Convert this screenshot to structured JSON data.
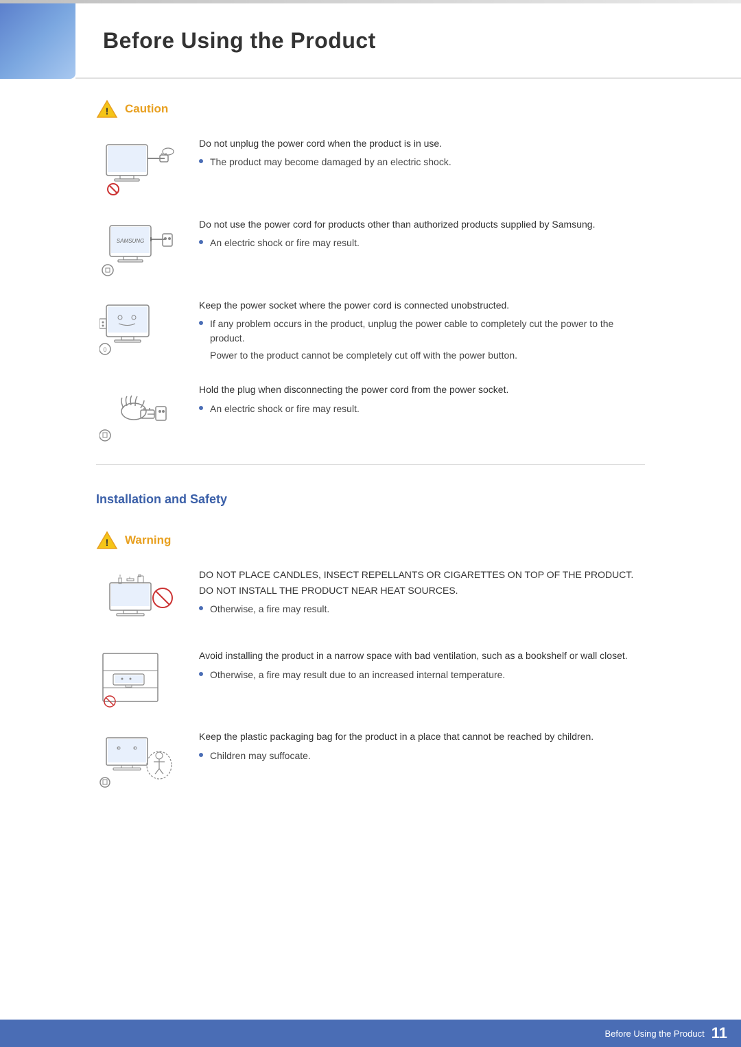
{
  "page": {
    "title": "Before Using the Product",
    "page_number": "11",
    "footer_label": "Before Using the Product"
  },
  "caution_section": {
    "heading": "Caution",
    "blocks": [
      {
        "id": "block1",
        "main_text": "Do not unplug the power cord when the product is in use.",
        "bullets": [
          "The product may become damaged by an electric shock."
        ],
        "sub_texts": []
      },
      {
        "id": "block2",
        "main_text": "Do not use the power cord for products other than authorized products supplied by Samsung.",
        "bullets": [
          "An electric shock or fire may result."
        ],
        "sub_texts": []
      },
      {
        "id": "block3",
        "main_text": "Keep the power socket where the power cord is connected unobstructed.",
        "bullets": [
          "If any problem occurs in the product, unplug the power cable to completely cut the power to the product."
        ],
        "sub_texts": [
          "Power to the product cannot be completely cut off with the power button."
        ]
      },
      {
        "id": "block4",
        "main_text": "Hold the plug when disconnecting the power cord from the power socket.",
        "bullets": [
          "An electric shock or fire may result."
        ],
        "sub_texts": []
      }
    ]
  },
  "install_section": {
    "heading": "Installation and Safety",
    "warning_heading": "Warning",
    "blocks": [
      {
        "id": "iblock1",
        "main_text": "DO NOT PLACE CANDLES, INSECT REPELLANTS OR CIGARETTES ON TOP OF THE PRODUCT. DO NOT INSTALL THE PRODUCT NEAR HEAT SOURCES.",
        "bullets": [
          "Otherwise, a fire may result."
        ],
        "sub_texts": []
      },
      {
        "id": "iblock2",
        "main_text": "Avoid installing the product in a narrow space with bad ventilation, such as a bookshelf or wall closet.",
        "bullets": [
          "Otherwise, a fire may result due to an increased internal temperature."
        ],
        "sub_texts": []
      },
      {
        "id": "iblock3",
        "main_text": "Keep the plastic packaging bag for the product in a place that cannot be reached by children.",
        "bullets": [
          "Children may suffocate."
        ],
        "sub_texts": []
      }
    ]
  }
}
